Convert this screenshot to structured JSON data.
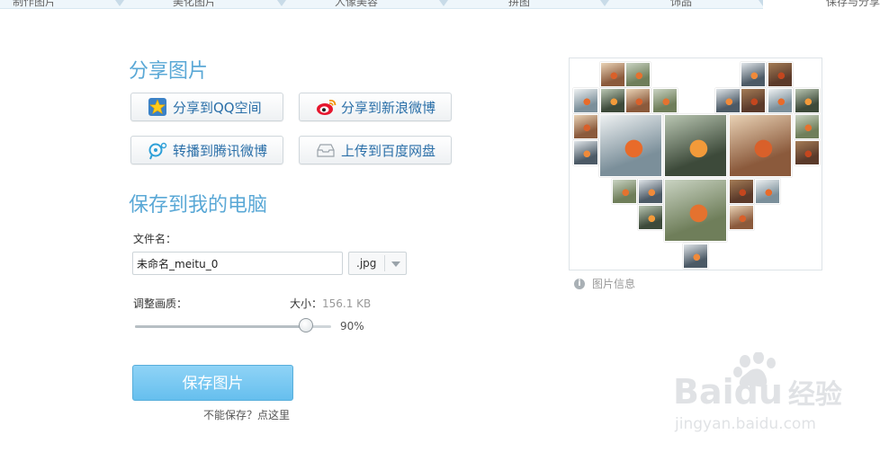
{
  "top_tabs": [
    "制作图片",
    "美化图片",
    "人像美容",
    "拼图",
    "饰品",
    "保存与分享"
  ],
  "share": {
    "title": "分享图片",
    "buttons": [
      {
        "label": "分享到QQ空间",
        "icon": "qzone-star-icon"
      },
      {
        "label": "分享到新浪微博",
        "icon": "sina-weibo-icon"
      },
      {
        "label": "转播到腾讯微博",
        "icon": "tencent-weibo-icon"
      },
      {
        "label": "上传到百度网盘",
        "icon": "baidu-cloud-icon"
      }
    ]
  },
  "save": {
    "title": "保存到我的电脑",
    "filename_label": "文件名：",
    "filename_value": "未命名_meitu_0",
    "extension": ".jpg",
    "quality_label": "调整画质：",
    "size_label": "大小：",
    "size_value": "156.1 KB",
    "quality_percent": 90,
    "quality_text": "90%",
    "save_button": "保存图片",
    "cant_save_link": "不能保存？点这里"
  },
  "preview": {
    "info_label": "图片信息"
  },
  "watermark": {
    "brand": "Baidu",
    "suffix": "经验",
    "url": "jingyan.baidu.com"
  },
  "colors": {
    "accent": "#5aa8d6",
    "save_button": "#7ccbf2",
    "link": "#2a6fa8"
  }
}
